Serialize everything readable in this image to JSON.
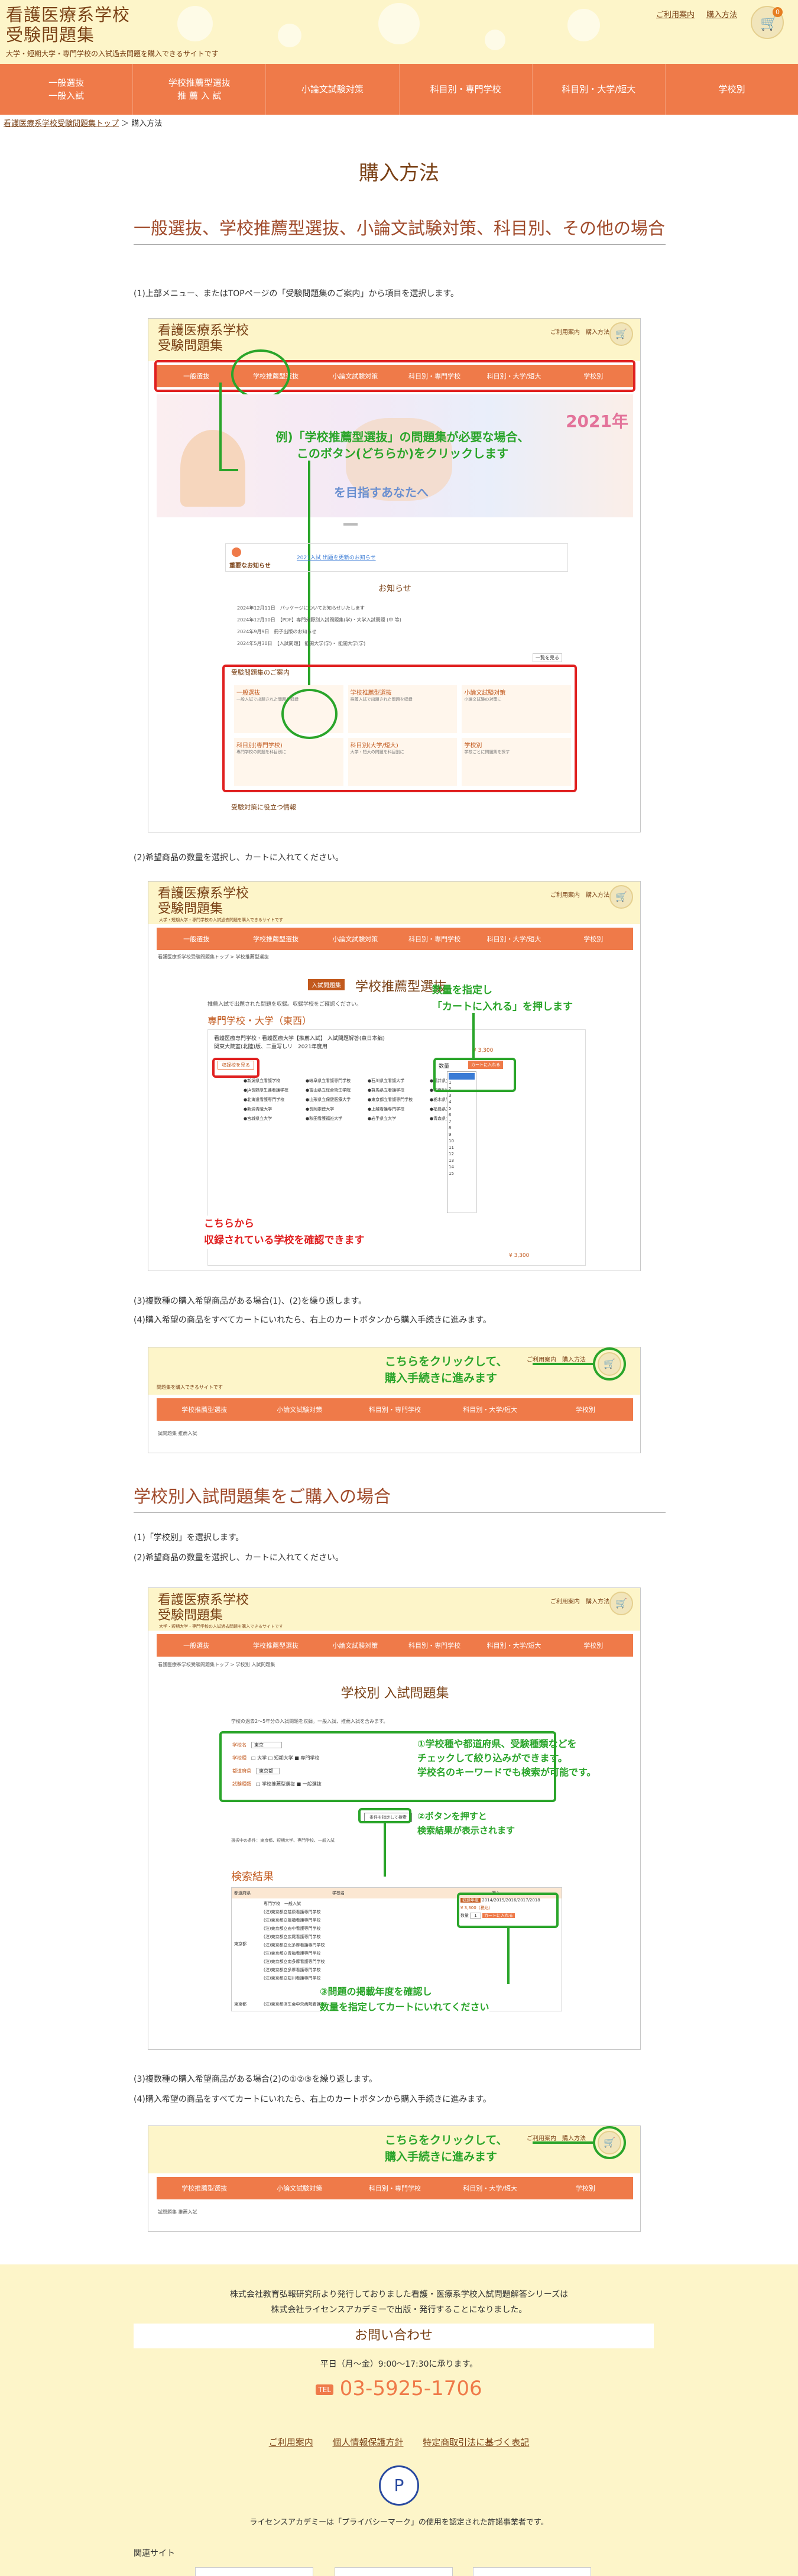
{
  "header": {
    "logo_line1": "看護医療系学校",
    "logo_line2": "受験問題集",
    "tagline": "大学・短期大学・専門学校の入試過去問題を購入できるサイトです",
    "link_guide": "ご利用案内",
    "link_cart": "購入方法",
    "cart_count": "0",
    "cart_icon": "cart-icon"
  },
  "nav": [
    {
      "label": "一般選抜\n一般入試"
    },
    {
      "label": "学校推薦型選抜\n推 薦 入 試"
    },
    {
      "label": "小論文試験対策"
    },
    {
      "label": "科目別・専門学校"
    },
    {
      "label": "科目別・大学/短大"
    },
    {
      "label": "学校別"
    }
  ],
  "breadcrumb": {
    "home": "看護医療系学校受験問題集トップ",
    "current": "購入方法"
  },
  "page_title": "購入方法",
  "section1": {
    "heading": "一般選抜、学校推薦型選抜、小論文試験対策、科目別、その他の場合",
    "step1": "(1)上部メニュー、またはTOPページの「受験問題集のご案内」から項目を選択します。",
    "step2": "(2)希望商品の数量を選択し、カートに入れてください。",
    "step3": "(3)複数種の購入希望商品がある場合(1)、(2)を繰り返します。",
    "step4": "(4)購入希望の商品をすべてカートにいれたら、右上のカートボタンから購入手続きに進みます。"
  },
  "shot1": {
    "logo1": "看護医療系学校",
    "logo2": "受験問題集",
    "links": "ご利用案内　購入方法",
    "nav": [
      "一般選抜",
      "学校推薦型選抜",
      "小論文試験対策",
      "科目別・専門学校",
      "科目別・大学/短大",
      "学校別"
    ],
    "banner_year": "2021年",
    "banner_sub": "を目指すあなたへ",
    "callout": "例)「学校推薦型選抜」の問題集が必要な場合、\nこのボタン(どちらか)をクリックします",
    "notice_title": "重要なお知らせ",
    "notice_text": "2021入試 出題を更新のお知らせ",
    "news_title": "お知らせ",
    "news": [
      "2024年12月11日　パッケージについてお知らせいたします",
      "2024年12月10日　【PDF】専門分野別入試問題集(学)・大学入試問題 (中 等)",
      "2024年9月9日　冊子出版のお知らせ",
      "2024年5月30日　【入試問題】 能開大学(学)・ 能開大学(学)"
    ],
    "more": "一覧を見る",
    "guide_title": "受験問題集のご案内",
    "guide_items": [
      {
        "title": "一般選抜",
        "desc": "一般入試で出題された問題を収録"
      },
      {
        "title": "学校推薦型選抜",
        "desc": "推薦入試で出題された問題を収録"
      },
      {
        "title": "小論文試験対策",
        "desc": "小論文試験の対策に"
      },
      {
        "title": "科目別(専門学校)",
        "desc": "専門学校の問題を科目別に"
      },
      {
        "title": "科目別(大学/短大)",
        "desc": "大学・短大の問題を科目別に"
      },
      {
        "title": "学校別",
        "desc": "学校ごとに問題集を探す"
      }
    ],
    "footer_link": "受験対策に役立つ情報"
  },
  "shot2": {
    "logo1": "看護医療系学校",
    "logo2": "受験問題集",
    "tag": "大学・短期大学・専門学校の入試過去問題を購入できるサイトです",
    "links": "ご利用案内　購入方法",
    "nav": [
      "一般選抜",
      "学校推薦型選抜",
      "小論文試験対策",
      "科目別・専門学校",
      "科目別・大学/短大",
      "学校別"
    ],
    "crumb": "看護医療系学校受験問題集トップ > 学校推薦型選抜",
    "badge": "入試問題集",
    "title": "学校推薦型選抜",
    "intro": "推薦入試で出題された問題を収録。収録学校をご確認ください。",
    "subhead": "専門学校・大学（東西）",
    "product": "看護医療専門学校・看護医療大学【推薦入試】 入試問題解答(東日本編)\n関東大院室(北陸)版、二重写しリ　2021年度用",
    "price": "¥ 3,300",
    "qty_label": "数量",
    "cart_btn": "カートに入れる",
    "list_btn": "収録校を見る",
    "callout_right": "数量を指定し\n「カートに入れる」を押します",
    "callout_left": "こちらから\n収録されている学校を確認できます",
    "qty_options": [
      "1",
      "2",
      "3",
      "4",
      "5",
      "6",
      "7",
      "8",
      "9",
      "10",
      "11",
      "12",
      "13",
      "14",
      "15"
    ],
    "schools": [
      "●新潟県立看護学校",
      "●岐阜県立看護専門学校",
      "●石川県立看護大学",
      "●福井県立大学",
      "●JA長野厚生連看護学校",
      "●富山県立総合衛生学院",
      "●群馬県立看護学校",
      "●神奈川県立看護学校",
      "●北海道看護専門学校",
      "●山形県立保健医療大学",
      "●東京都立看護専門学校",
      "●栃木県看護学校",
      "●新潟青陵大学",
      "●長岡崇徳大学",
      "●上越看護専門学校",
      "●福島県立看護学校",
      "●宮城県立大学",
      "●秋田看護福祉大学",
      "●岩手県立大学",
      "●青森県立保健大学"
    ],
    "bottom_price": "¥ 3,300"
  },
  "shot3": {
    "callout": "こちらをクリックして、\n購入手続きに進みます",
    "links": "ご利用案内　購入方法",
    "tag": "問題集を購入できるサイトです",
    "nav": [
      "学校推薦型選抜",
      "小論文試験対策",
      "科目別・専門学校",
      "科目別・大学/短大",
      "学校別"
    ],
    "crumb": "試問題集 推薦入試"
  },
  "section2": {
    "heading": "学校別入試問題集をご購入の場合",
    "step1": "(1)「学校別」を選択します。",
    "step2": "(2)希望商品の数量を選択し、カートに入れてください。",
    "step3": "(3)複数種の購入希望商品がある場合(2)の①②③を繰り返します。",
    "step4": "(4)購入希望の商品をすべてカートにいれたら、右上のカートボタンから購入手続きに進みます。"
  },
  "shot4": {
    "logo1": "看護医療系学校",
    "logo2": "受験問題集",
    "tag": "大学・短期大学・専門学校の入試過去問題を購入できるサイトです",
    "links": "ご利用案内　購入方法",
    "nav": [
      "一般選抜",
      "学校推薦型選抜",
      "小論文試験対策",
      "科目別・専門学校",
      "科目別・大学/短大",
      "学校別"
    ],
    "crumb": "看護医療系学校受験問題集トップ > 学校別 入試問題集",
    "title": "学校別 入試問題集",
    "intro": "学校の過去2〜5年分の入試問題を収録。一般入試、推薦入試を含みます。",
    "field_school": "学校名",
    "field_school_val": "東京",
    "field_type": "学校種",
    "field_type_opts": "□ 大学 □ 短期大学 ■ 専門学校",
    "field_pref": "都道府県",
    "field_pref_val": "東京都",
    "field_exam": "試験種類",
    "field_exam_opts": "□ 学校推薦型選抜 ■ 一般選抜",
    "search_btn": "条件を指定して検索",
    "callout1": "①学校種や都道府県、受験種類などを\nチェックして絞り込みができます。\n学校名のキーワードでも検索が可能です。",
    "callout2": "②ボタンを押すと\n検索結果が表示されます",
    "note": "選択中の条件：東京都、短期大学、専門学校、一般入試",
    "results_title": "検索結果",
    "col_region": "都道府県",
    "col_school": "学校名",
    "col_buy": "購入",
    "region": "東京都",
    "results": [
      "専門学校　一般入試",
      "(注)東京都立荏原看護専門学校",
      "(注)東京都立板橋看護専門学校",
      "(注)東京都立府中看護専門学校",
      "(注)東京都立広尾看護専門学校",
      "(注)東京都立北多摩看護専門学校",
      "(注)東京都立青梅看護専門学校",
      "(注)東京都立南多摩看護専門学校",
      "(注)東京都立多摩看護専門学校",
      "(注)東京都立桜川看護専門学校"
    ],
    "result_badge": "収録年度",
    "result_years": "2014/2015/2016/2017/2018",
    "result_price": "¥ 3,300（税込）",
    "result_qty": "数量",
    "result_cart": "カートに入れる",
    "callout3": "③問題の掲載年度を確認し\n数量を指定してカートにいれてください",
    "last_region": "東京都",
    "last_row": "(注)東京都済生会中央病院看護専門学校"
  },
  "shot5": {
    "callout": "こちらをクリックして、\n購入手続きに進みます",
    "links": "ご利用案内　購入方法",
    "nav": [
      "学校推薦型選抜",
      "小論文試験対策",
      "科目別・専門学校",
      "科目別・大学/短大",
      "学校別"
    ],
    "crumb": "試問題集 推薦入試"
  },
  "footer": {
    "line1": "株式会社教育弘報研究所より発行しておりました看護・医療系学校入試問題解答シリーズは",
    "line2": "株式会社ライセンスアカデミーで出版・発行することになりました。",
    "contact_title": "お問い合わせ",
    "hours": "平日（月〜金）9:00〜17:30に承ります。",
    "tel_label": "TEL",
    "tel": "03-5925-1706",
    "links": [
      "ご利用案内",
      "個人情報保護方針",
      "特定商取引法に基づく表記"
    ],
    "privacy_note": "ライセンスアカデミーは「プライバシーマーク」の使用を認定された許諾事業者です。",
    "related": "関連サイト"
  },
  "colors": {
    "accent": "#ef7a49",
    "brown": "#7a4116",
    "cream": "#fdf5c9",
    "red": "#e02020",
    "green": "#2aa52a"
  }
}
